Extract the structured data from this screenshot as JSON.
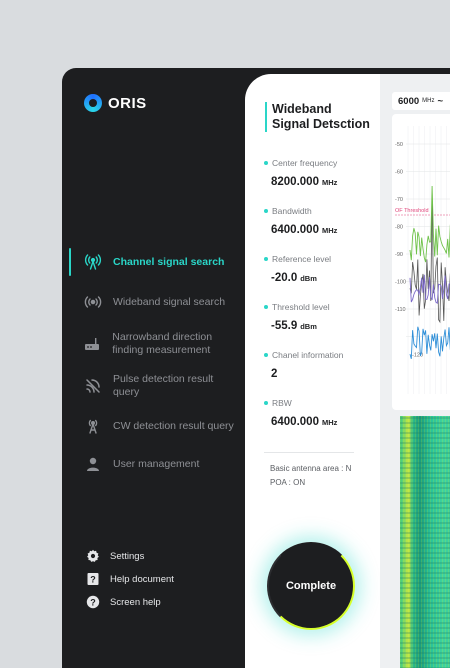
{
  "app": {
    "name": "ORIS"
  },
  "sidebar": {
    "items": [
      {
        "label": "Channel signal search",
        "icon": "antenna-icon",
        "active": true
      },
      {
        "label": "Wideband signal search",
        "icon": "broadcast-icon",
        "active": false
      },
      {
        "label": "Narrowband direction finding measurement",
        "icon": "router-icon",
        "active": false
      },
      {
        "label": "Pulse detection result query",
        "icon": "signal-wave-icon",
        "active": false
      },
      {
        "label": "CW detection result query",
        "icon": "tower-icon",
        "active": false
      },
      {
        "label": "User management",
        "icon": "user-icon",
        "active": false
      }
    ],
    "bottom": [
      {
        "label": "Settings",
        "icon": "gear-icon"
      },
      {
        "label": "Help document",
        "icon": "document-help-icon"
      },
      {
        "label": "Screen help",
        "icon": "question-circle-icon"
      }
    ]
  },
  "panel": {
    "title_line1": "Wideband",
    "title_line2": "Signal Detsction",
    "params": [
      {
        "label": "Center frequency",
        "value": "8200.000",
        "unit": "MHz"
      },
      {
        "label": "Bandwidth",
        "value": "6400.000",
        "unit": "MHz"
      },
      {
        "label": "Reference level",
        "value": "-20.0",
        "unit": "dBm"
      },
      {
        "label": "Threshold level",
        "value": "-55.9",
        "unit": "dBm"
      },
      {
        "label": "Chanel information",
        "value": "2",
        "unit": ""
      },
      {
        "label": "RBW",
        "value": "6400.000",
        "unit": "MHz"
      }
    ],
    "antenna_info": "Basic antenna area : N",
    "poa_info": "POA : ON",
    "complete_label": "Complete"
  },
  "spectrum": {
    "freq_value": "6000",
    "freq_unit": "MHz",
    "freq_suffix": "~",
    "threshold_label": "OF Threshold",
    "ylabels": [
      "-50",
      "-60",
      "-70",
      "-80",
      "-90",
      "-100",
      "-110",
      "-120"
    ],
    "colors": {
      "green": "#6fc24a",
      "purple": "#7b68c9",
      "blue": "#2f8fd8",
      "gray": "#555555",
      "threshold": "#e0457b"
    }
  },
  "colors": {
    "accent": "#2ad6c8",
    "sidebar_bg": "#1d1e20",
    "complete_ring": "#d6ff2a"
  }
}
